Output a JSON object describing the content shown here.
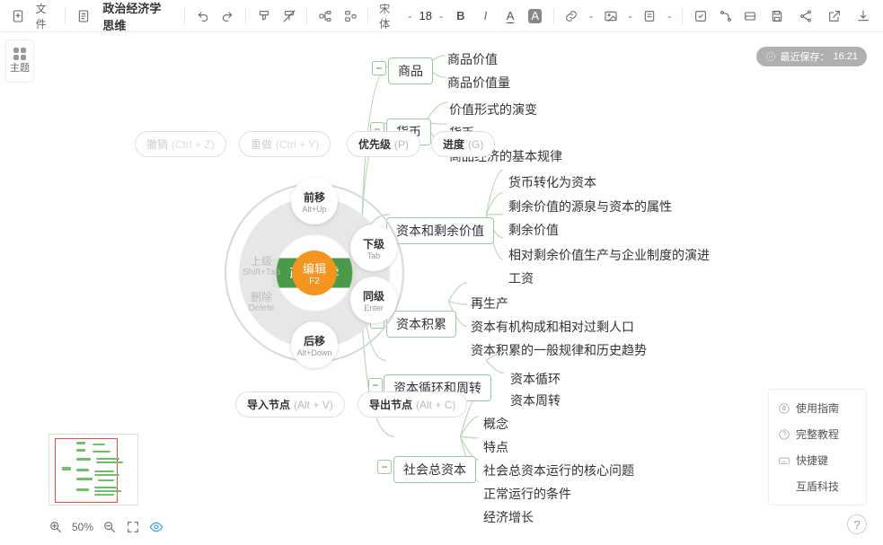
{
  "toolbar": {
    "file_label": "文件",
    "doc_title": "政治经济学思维",
    "font_name": "宋体",
    "font_size": "18",
    "bold": "B",
    "italic": "I",
    "text_color_glyph": "A",
    "highlight_glyph": "A"
  },
  "theme_label": "主题",
  "autosave": {
    "label": "最近保存：",
    "time": "16:21"
  },
  "radial": {
    "center_label": "编辑",
    "center_key": "F2",
    "behind_left": "政",
    "behind_right": "学",
    "up": {
      "label": "上级",
      "key": "Shift+Tab"
    },
    "del": {
      "label": "删除",
      "key": "Delete"
    },
    "pill_top": {
      "label": "前移",
      "key": "Alt+Up"
    },
    "pill_right_top": {
      "label": "下级",
      "key": "Tab"
    },
    "pill_right_bottom": {
      "label": "同级",
      "key": "Enter"
    },
    "pill_bottom": {
      "label": "后移",
      "key": "Alt+Down"
    }
  },
  "ghosts": {
    "undo": {
      "label": "撤销",
      "key": "(Ctrl + Z)"
    },
    "redo": {
      "label": "重做",
      "key": "(Ctrl + Y)"
    },
    "priority": {
      "label": "优先级",
      "key": "(P)"
    },
    "progress": {
      "label": "进度",
      "key": "(G)"
    },
    "import": {
      "label": "导入节点",
      "key": "(Alt + V)"
    },
    "export": {
      "label": "导出节点",
      "key": "(Alt + C)"
    }
  },
  "nodes": {
    "n1": {
      "label": "商品",
      "children": [
        "商品价值",
        "商品价值量"
      ]
    },
    "n2": {
      "label": "货币",
      "children": [
        "价值形式的演变",
        "货币",
        "商品经济的基本规律"
      ]
    },
    "n3": {
      "label": "资本和剩余价值",
      "children": [
        "货币转化为资本",
        "剩余价值的源泉与资本的属性",
        "剩余价值",
        "相对剩余价值生产与企业制度的演进",
        "工资"
      ]
    },
    "n4": {
      "label": "资本积累",
      "children": [
        "再生产",
        "资本有机构成和相对过剩人口",
        "资本积累的一般规律和历史趋势"
      ]
    },
    "n5": {
      "label": "资本循环和周转",
      "children": [
        "资本循环",
        "资本周转"
      ]
    },
    "n6": {
      "label": "社会总资本",
      "children": [
        "概念",
        "特点",
        "社会总资本运行的核心问题",
        "正常运行的条件",
        "经济增长"
      ]
    }
  },
  "zoom": {
    "value": "50%"
  },
  "help": {
    "guide": "使用指南",
    "tutorial": "完整教程",
    "shortcuts": "快捷键",
    "brand": "互盾科技"
  }
}
